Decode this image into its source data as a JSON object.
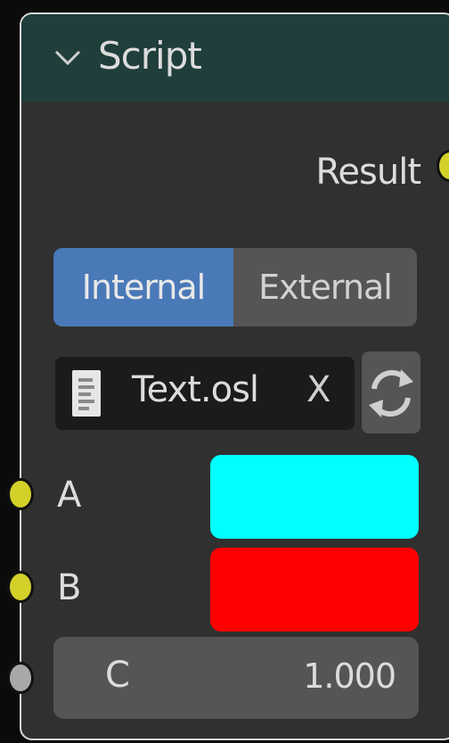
{
  "node": {
    "title": "Script",
    "header_color": "#1f3e3c",
    "outputs": [
      {
        "label": "Result",
        "socket_color": "#d3d02a"
      }
    ],
    "source_mode": {
      "options": [
        "Internal",
        "External"
      ],
      "selected": "Internal",
      "accent": "#4a79b8"
    },
    "script_file": {
      "name": "Text.osl",
      "clear_label": "X",
      "icon": "text-file-icon",
      "reload_icon": "reload-icon"
    },
    "inputs": [
      {
        "label": "A",
        "type": "color",
        "value": "#00ffff",
        "socket_color": "#d3d02a"
      },
      {
        "label": "B",
        "type": "color",
        "value": "#ff0000",
        "socket_color": "#d3d02a"
      },
      {
        "label": "C",
        "type": "float",
        "value": "1.000",
        "socket_color": "#a8a8a8"
      }
    ]
  }
}
